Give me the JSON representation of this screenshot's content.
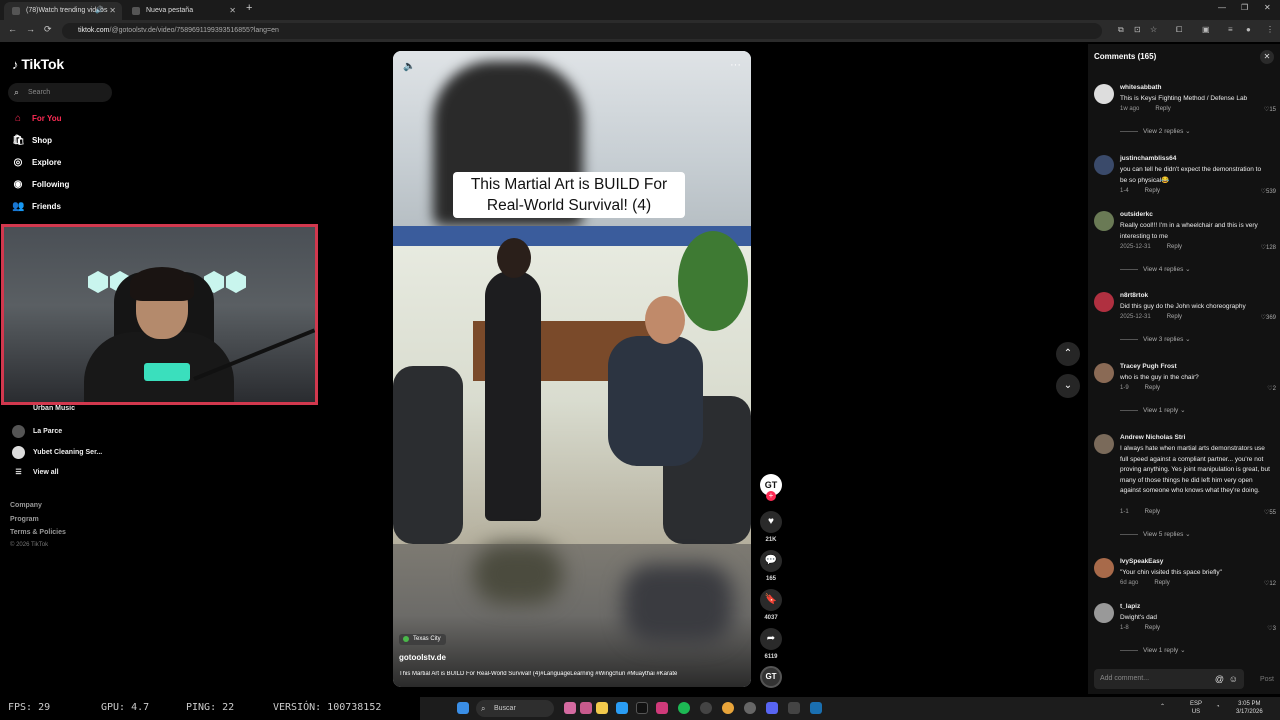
{
  "browser": {
    "tabs": [
      {
        "title": "(78)Watch trending videos"
      },
      {
        "title": "Nueva pestaña"
      }
    ],
    "url_domain": "tiktok.com",
    "url_path": "/@gotoolstv.de/video/7589691199393516855?lang=en"
  },
  "sidebar": {
    "logo": "TikTok",
    "search_placeholder": "Search",
    "nav": [
      {
        "label": "For You",
        "icon": "home-icon"
      },
      {
        "label": "Shop",
        "icon": "shop-icon"
      },
      {
        "label": "Explore",
        "icon": "compass-icon"
      },
      {
        "label": "Following",
        "icon": "following-icon"
      },
      {
        "label": "Friends",
        "icon": "friends-icon"
      }
    ],
    "following_accounts": [
      {
        "name": "Urban Music"
      },
      {
        "name": "La Parce"
      },
      {
        "name": "Yubet Cleaning Ser..."
      }
    ],
    "view_all": "View all",
    "footer_links": [
      "Company",
      "Program",
      "Terms & Policies"
    ],
    "copyright": "© 2026 TikTok"
  },
  "video": {
    "caption_line1": "This Martial Art is BUILD For",
    "caption_line2": "Real-World Survival! (4)",
    "location": "Texas City",
    "author": "gotoolstv.de",
    "description": "This Martial Art is BUILD For Real-World Survival! (4)#LanguageLearning #Wingchun #Muaythai #Karate",
    "creator_badge": "GT",
    "likes": "21K",
    "comments": "165",
    "saves": "4037",
    "shares": "6119"
  },
  "comments_panel": {
    "title": "Comments (165)",
    "items": [
      {
        "user": "whitesabbath",
        "text": "This is Keysi Fighting Method / Defense Lab",
        "date": "1w ago",
        "likes": "15",
        "replies": "View 2 replies"
      },
      {
        "user": "justinchambliss64",
        "text": "you can tell he didn't expect the demonstration to be so physical😂",
        "date": "1-4",
        "likes": "539",
        "replies": ""
      },
      {
        "user": "outsiderkc",
        "text": "Really cool!!! I'm in a wheelchair and this is very interesting to me",
        "date": "2025-12-31",
        "likes": "128",
        "replies": "View 4 replies"
      },
      {
        "user": "n8rt8rtok",
        "text": "Did this guy do the John wick choreography",
        "date": "2025-12-31",
        "likes": "369",
        "replies": "View 3 replies"
      },
      {
        "user": "Tracey Pugh Frost",
        "text": "who is the guy in the chair?",
        "date": "1-9",
        "likes": "2",
        "replies": "View 1 reply"
      },
      {
        "user": "Andrew Nicholas Stri",
        "text": "I always hate when martial arts demonstrators use full speed against a compliant partner... you're not proving anything. Yes joint manipulation is great, but many of those things he did left him very open against someone who knows what they're doing.",
        "date": "1-1",
        "likes": "55",
        "replies": "View 5 replies"
      },
      {
        "user": "IvySpeakEasy",
        "text": "\"Your chin visited this space briefly\"",
        "date": "6d ago",
        "likes": "12",
        "replies": ""
      },
      {
        "user": "t_lapiz",
        "text": "Dwight's dad",
        "date": "1-8",
        "likes": "3",
        "replies": "View 1 reply"
      }
    ],
    "reply_label": "Reply",
    "input_placeholder": "Add comment...",
    "post_label": "Post"
  },
  "stream_stats": {
    "fps": "FPS: 29",
    "gpu": "GPU: 4.7",
    "ping": "PING: 22",
    "version": "VERSIÓN: 100738152"
  },
  "taskbar": {
    "search_label": "Buscar",
    "lang1": "ESP",
    "lang2": "US",
    "time": "3:05 PM",
    "date": "3/17/2026"
  }
}
